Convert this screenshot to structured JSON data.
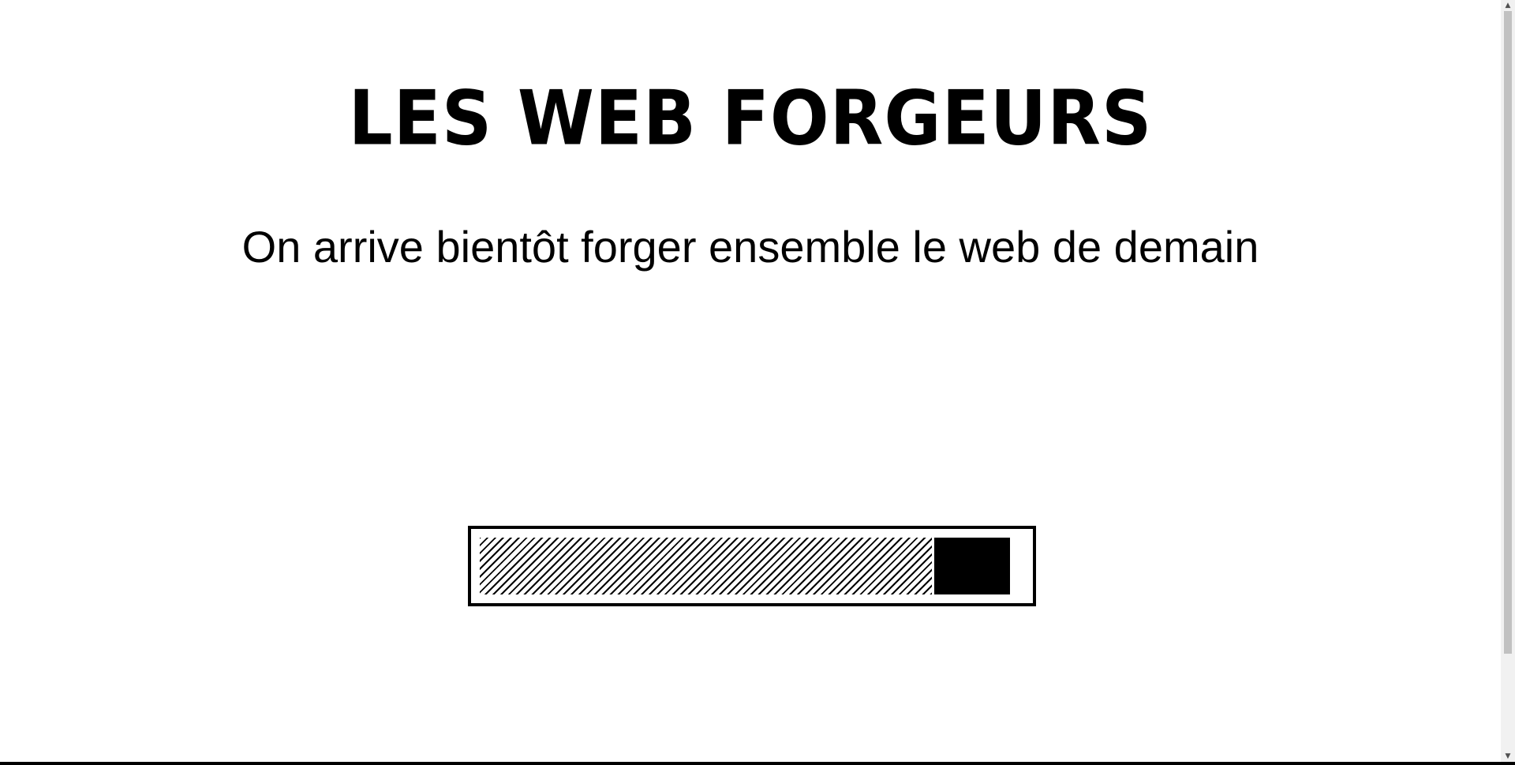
{
  "header": {
    "title": "LES WEB FORGEURS"
  },
  "main": {
    "tagline": "On arrive bientôt forger ensemble le web de demain"
  },
  "progress": {
    "value": 0.83
  },
  "scrollbar": {
    "up_arrow": "▲",
    "down_arrow": "▼"
  }
}
